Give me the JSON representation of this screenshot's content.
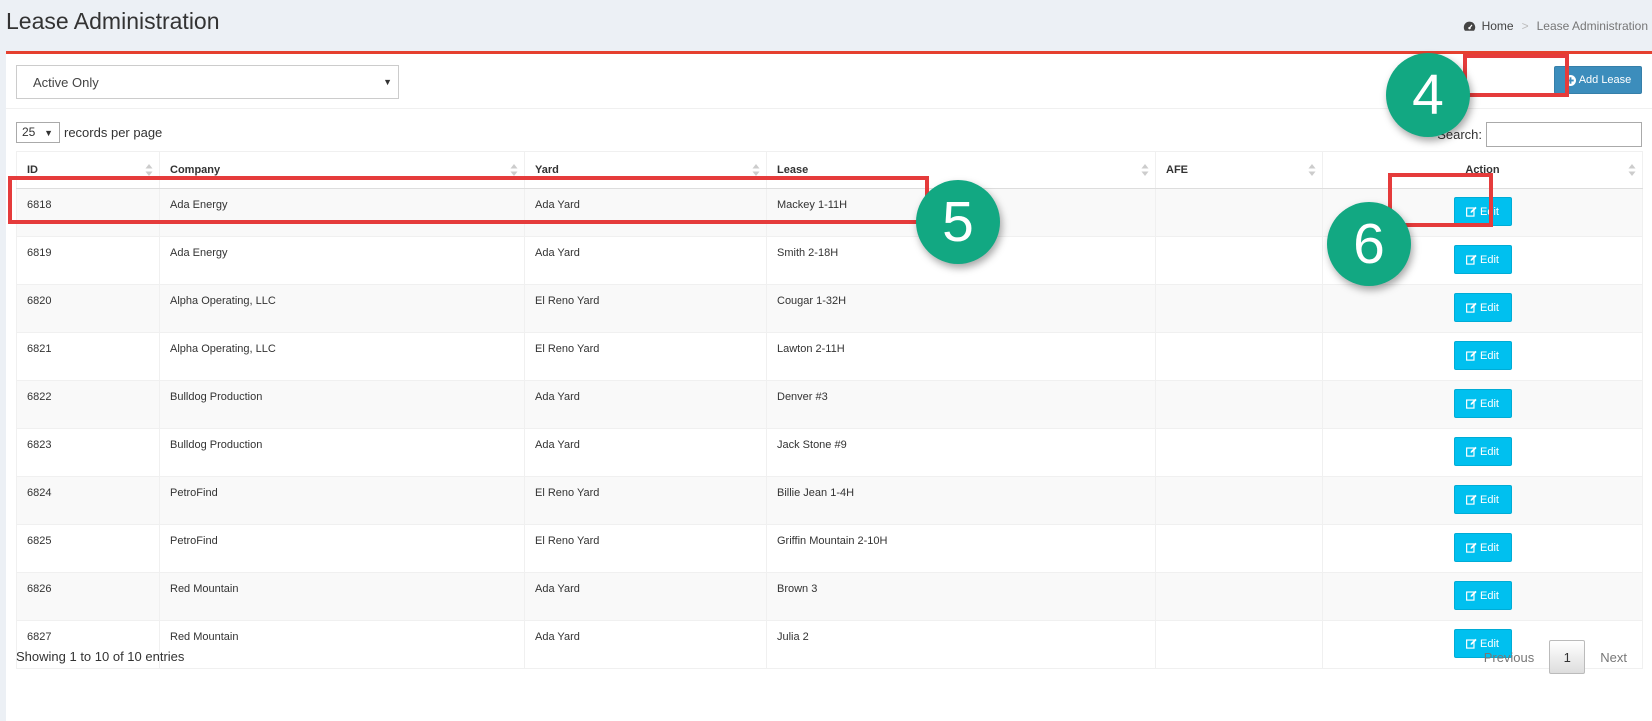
{
  "page": {
    "title": "Lease Administration"
  },
  "breadcrumb": {
    "home": "Home",
    "separator": ">",
    "current": "Lease Administration",
    "home_icon": "dashboard-icon"
  },
  "filter": {
    "selected": "Active Only"
  },
  "toolbar": {
    "add_label": "Add Lease",
    "add_icon": "plus-circle-icon"
  },
  "table_controls": {
    "page_length": "25",
    "length_label": "records per page",
    "search_label": "Search:",
    "search_value": ""
  },
  "table": {
    "columns": [
      "ID",
      "Company",
      "Yard",
      "Lease",
      "AFE",
      "Action"
    ],
    "rows": [
      {
        "id": "6818",
        "company": "Ada Energy",
        "yard": "Ada Yard",
        "lease": "Mackey 1-11H",
        "afe": "",
        "action": "Edit"
      },
      {
        "id": "6819",
        "company": "Ada Energy",
        "yard": "Ada Yard",
        "lease": "Smith 2-18H",
        "afe": "",
        "action": "Edit"
      },
      {
        "id": "6820",
        "company": "Alpha Operating, LLC",
        "yard": "El Reno Yard",
        "lease": "Cougar 1-32H",
        "afe": "",
        "action": "Edit"
      },
      {
        "id": "6821",
        "company": "Alpha Operating, LLC",
        "yard": "El Reno Yard",
        "lease": "Lawton 2-11H",
        "afe": "",
        "action": "Edit"
      },
      {
        "id": "6822",
        "company": "Bulldog Production",
        "yard": "Ada Yard",
        "lease": "Denver #3",
        "afe": "",
        "action": "Edit"
      },
      {
        "id": "6823",
        "company": "Bulldog Production",
        "yard": "Ada Yard",
        "lease": "Jack Stone #9",
        "afe": "",
        "action": "Edit"
      },
      {
        "id": "6824",
        "company": "PetroFind",
        "yard": "El Reno Yard",
        "lease": "Billie Jean 1-4H",
        "afe": "",
        "action": "Edit"
      },
      {
        "id": "6825",
        "company": "PetroFind",
        "yard": "El Reno Yard",
        "lease": "Griffin Mountain 2-10H",
        "afe": "",
        "action": "Edit"
      },
      {
        "id": "6826",
        "company": "Red Mountain",
        "yard": "Ada Yard",
        "lease": "Brown 3",
        "afe": "",
        "action": "Edit"
      },
      {
        "id": "6827",
        "company": "Red Mountain",
        "yard": "Ada Yard",
        "lease": "Julia 2",
        "afe": "",
        "action": "Edit"
      }
    ]
  },
  "footer": {
    "info": "Showing 1 to 10 of 10 entries"
  },
  "pagination": {
    "previous": "Previous",
    "current": "1",
    "next": "Next"
  },
  "annotations": {
    "step4": "4",
    "step5": "5",
    "step6": "6"
  },
  "colors": {
    "accent": "#e5402f",
    "primary": "#3c8dbc",
    "info": "#00c0ef",
    "annotation_box": "#e53b3b",
    "annotation_badge": "#12a882"
  }
}
